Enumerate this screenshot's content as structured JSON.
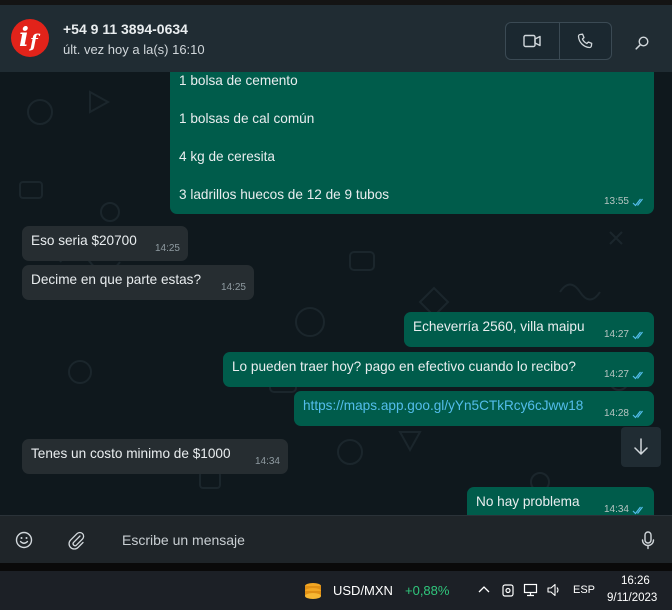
{
  "header": {
    "contact_name": "+54 9 11 3894-0634",
    "contact_status": "últ. vez hoy a la(s) 16:10",
    "avatar_letters": "if",
    "icons": [
      "video-call-icon",
      "voice-call-icon",
      "search-icon"
    ]
  },
  "messages": [
    {
      "direction": "out",
      "lines": [
        "1 bolsa de cemento",
        "1 bolsas de cal común",
        "4 kg de ceresita",
        "3 ladrillos huecos de 12 de 9 tubos"
      ],
      "time": "13:55",
      "status": "read"
    },
    {
      "direction": "in",
      "text": "Eso seria $20700",
      "time": "14:25"
    },
    {
      "direction": "in",
      "text": "Decime en que parte estas?",
      "time": "14:25"
    },
    {
      "direction": "out",
      "text": "Echeverría 2560, villa maipu",
      "time": "14:27",
      "status": "read"
    },
    {
      "direction": "out",
      "text": "Lo pueden traer hoy? pago en efectivo cuando lo recibo?",
      "time": "14:27",
      "status": "read"
    },
    {
      "direction": "out",
      "text": "https://maps.app.goo.gl/yYn5CTkRcy6cJww18",
      "time": "14:28",
      "status": "read",
      "is_link": true
    },
    {
      "direction": "in",
      "text": "Tenes un costo minimo de $1000",
      "time": "14:34"
    },
    {
      "direction": "out",
      "text": "No hay problema",
      "time": "14:34",
      "status": "read"
    }
  ],
  "composer": {
    "placeholder": "Escribe un mensaje",
    "icons": [
      "emoji-icon",
      "attach-icon",
      "mic-icon"
    ]
  },
  "taskbar": {
    "stock_name": "USD/MXN",
    "stock_change": "+0,88%",
    "language": "ESP",
    "time": "16:26",
    "date": "9/11/2023",
    "tray_icons": [
      "chevron-up-icon",
      "camera-icon",
      "network-icon",
      "volume-icon"
    ]
  },
  "colors": {
    "outgoing_bubble": "#005c4b",
    "incoming_bubble": "#262d31",
    "read_ticks": "#53bdeb",
    "link": "#53bdeb",
    "stock_up": "#30c67c"
  }
}
